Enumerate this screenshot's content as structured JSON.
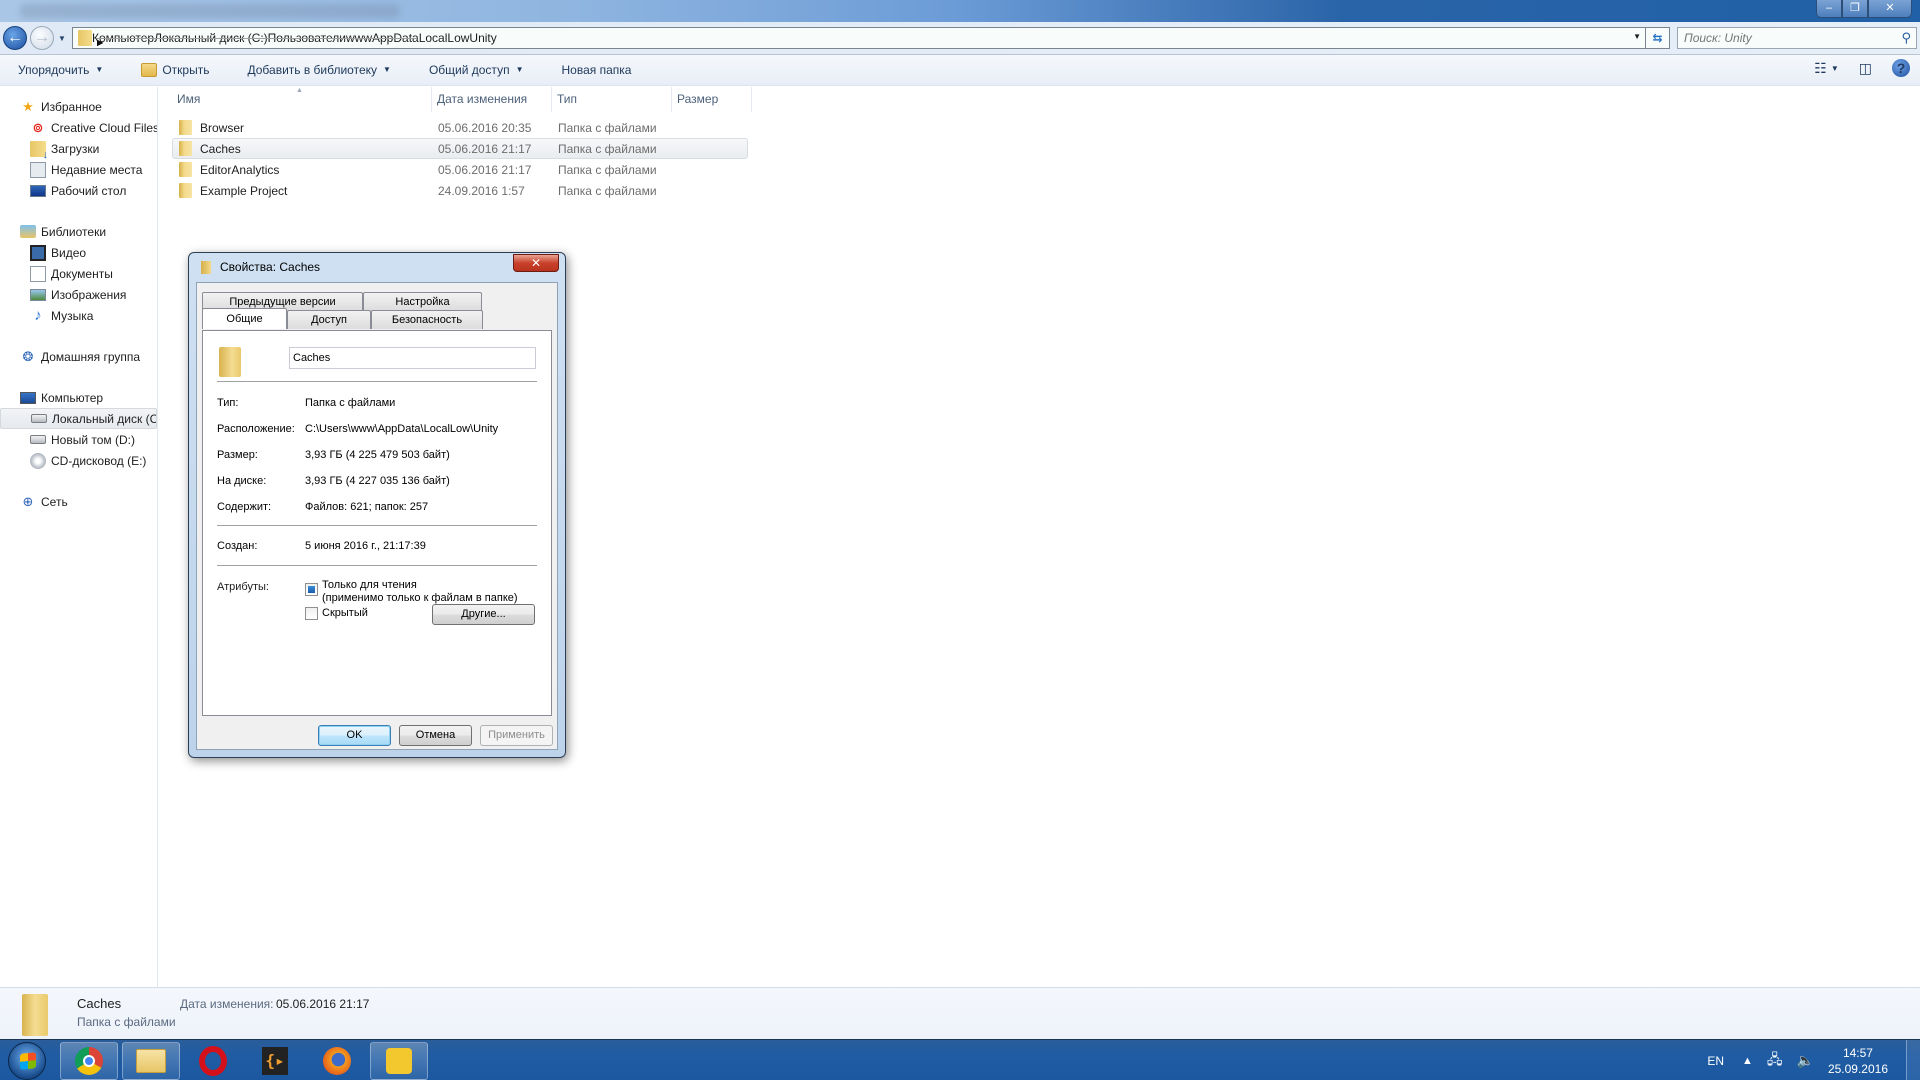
{
  "window": {
    "title_blurred": true,
    "controls": {
      "minimize": "‒",
      "maximize": "❐",
      "close": "✕"
    }
  },
  "address_bar": {
    "breadcrumbs": [
      "Компьютер",
      "Локальный диск (C:)",
      "Пользователи",
      "www",
      "AppData",
      "LocalLow",
      "Unity"
    ],
    "search_placeholder": "Поиск: Unity"
  },
  "command_bar": {
    "organize": "Упорядочить",
    "open": "Открыть",
    "add_to_library": "Добавить в библиотеку",
    "share": "Общий доступ",
    "new_folder": "Новая папка"
  },
  "sidebar": {
    "favorites": {
      "label": "Избранное",
      "items": [
        "Creative Cloud Files",
        "Загрузки",
        "Недавние места",
        "Рабочий стол"
      ]
    },
    "libraries": {
      "label": "Библиотеки",
      "items": [
        "Видео",
        "Документы",
        "Изображения",
        "Музыка"
      ]
    },
    "homegroup": {
      "label": "Домашняя группа"
    },
    "computer": {
      "label": "Компьютер",
      "items": [
        "Локальный диск (C:)",
        "Новый том (D:)",
        "CD-дисковод (E:)"
      ],
      "selected_index": 0
    },
    "network": {
      "label": "Сеть"
    }
  },
  "file_list": {
    "columns": {
      "name": "Имя",
      "date": "Дата изменения",
      "type": "Тип",
      "size": "Размер"
    },
    "sort_column": "name",
    "rows": [
      {
        "name": "Browser",
        "date": "05.06.2016 20:35",
        "type": "Папка с файлами",
        "size": ""
      },
      {
        "name": "Caches",
        "date": "05.06.2016 21:17",
        "type": "Папка с файлами",
        "size": "",
        "selected": true
      },
      {
        "name": "EditorAnalytics",
        "date": "05.06.2016 21:17",
        "type": "Папка с файлами",
        "size": ""
      },
      {
        "name": "Example Project",
        "date": "24.09.2016 1:57",
        "type": "Папка с файлами",
        "size": ""
      }
    ]
  },
  "details_pane": {
    "name": "Caches",
    "type": "Папка с файлами",
    "modified_label": "Дата изменения:",
    "modified_value": "05.06.2016 21:17"
  },
  "dialog": {
    "title": "Свойства: Caches",
    "tabs_row1": [
      "Предыдущие версии",
      "Настройка"
    ],
    "tabs_row2": [
      "Общие",
      "Доступ",
      "Безопасность"
    ],
    "active_tab": "Общие",
    "folder_name": "Caches",
    "properties": {
      "type": {
        "label": "Тип:",
        "value": "Папка с файлами"
      },
      "location": {
        "label": "Расположение:",
        "value": "C:\\Users\\www\\AppData\\LocalLow\\Unity"
      },
      "size": {
        "label": "Размер:",
        "value": "3,93 ГБ (4 225 479 503 байт)"
      },
      "on_disk": {
        "label": "На диске:",
        "value": "3,93 ГБ (4 227 035 136 байт)"
      },
      "contains": {
        "label": "Содержит:",
        "value": "Файлов: 621; папок: 257"
      },
      "created": {
        "label": "Создан:",
        "value": "5 июня 2016 г., 21:17:39"
      }
    },
    "attributes": {
      "label": "Атрибуты:",
      "readonly_line1": "Только для чтения",
      "readonly_line2": "(применимо только к файлам в папке)",
      "readonly_state": "indeterminate",
      "hidden": "Скрытый",
      "hidden_state": "unchecked",
      "advanced_button": "Другие..."
    },
    "buttons": {
      "ok": "OK",
      "cancel": "Отмена",
      "apply": "Применить"
    }
  },
  "taskbar": {
    "apps": [
      "start",
      "chrome",
      "explorer",
      "opera",
      "brackets",
      "firefox",
      "puzzle-app"
    ],
    "language": "EN",
    "time": "14:57",
    "date": "25.09.2016"
  }
}
